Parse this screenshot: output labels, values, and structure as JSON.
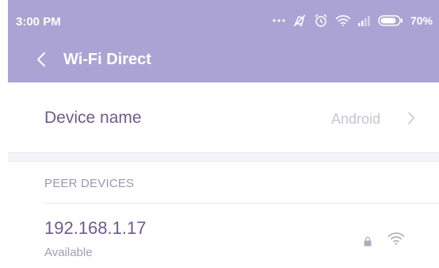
{
  "status_bar": {
    "time": "3:00 PM",
    "battery_percent": "70%",
    "icons": [
      "more-dots-icon",
      "mute-icon",
      "alarm-icon",
      "wifi-icon",
      "cell-signal-icon",
      "battery-icon"
    ]
  },
  "toolbar": {
    "title": "Wi-Fi Direct",
    "back_icon": "chevron-left-icon"
  },
  "device": {
    "label": "Device name",
    "value": "Android"
  },
  "peers": {
    "section_title": "PEER DEVICES",
    "items": [
      {
        "name": "192.168.1.17",
        "status": "Available",
        "secured": true,
        "signal_level": 3
      }
    ]
  },
  "colors": {
    "header_bg": "#aba3d3",
    "primary_text": "#6e5b8c",
    "secondary_text": "#a49bb6",
    "value_text": "#c9c3d3"
  }
}
